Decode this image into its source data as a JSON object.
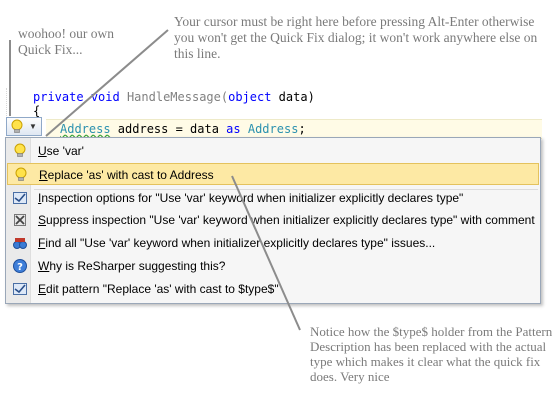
{
  "notes": {
    "left": "woohoo! our own Quick Fix...",
    "top": "Your cursor must be right here before pressing Alt-Enter otherwise you won't get the Quick Fix dialog; it won't work anywhere else on this line.",
    "bottom": "Notice how the $type$ holder from the Pattern Description has been replaced with the actual type which makes it clear what the quick fix does. Very nice"
  },
  "code": {
    "sig_kw1": "private",
    "sig_kw2": "void",
    "sig_name": " HandleMessage(",
    "sig_kw3": "object",
    "sig_rest": " data)",
    "brace": "{",
    "line_type": "Address",
    "line_mid": " address = data ",
    "line_kw": "as",
    "line_type2": "Address",
    "line_end": ";"
  },
  "menu": {
    "items": [
      {
        "key": "U",
        "label": "se 'var'"
      },
      {
        "key": "R",
        "label": "eplace 'as' with cast to Address"
      },
      {
        "key": "I",
        "label": "nspection options for \"Use 'var' keyword when initializer explicitly declares type\""
      },
      {
        "key": "S",
        "label": "uppress inspection \"Use 'var' keyword when initializer explicitly declares type\" with comment"
      },
      {
        "key": "F",
        "label": "ind all \"Use 'var' keyword when initializer explicitly declares type\" issues..."
      },
      {
        "key": "W",
        "label": "hy is ReSharper suggesting this?"
      },
      {
        "key": "E",
        "label": "dit pattern \"Replace 'as' with cast to $type$\""
      }
    ]
  },
  "colors": {
    "selection": "#fde9a4",
    "keyword": "#0000ff",
    "type": "#2b91af"
  }
}
